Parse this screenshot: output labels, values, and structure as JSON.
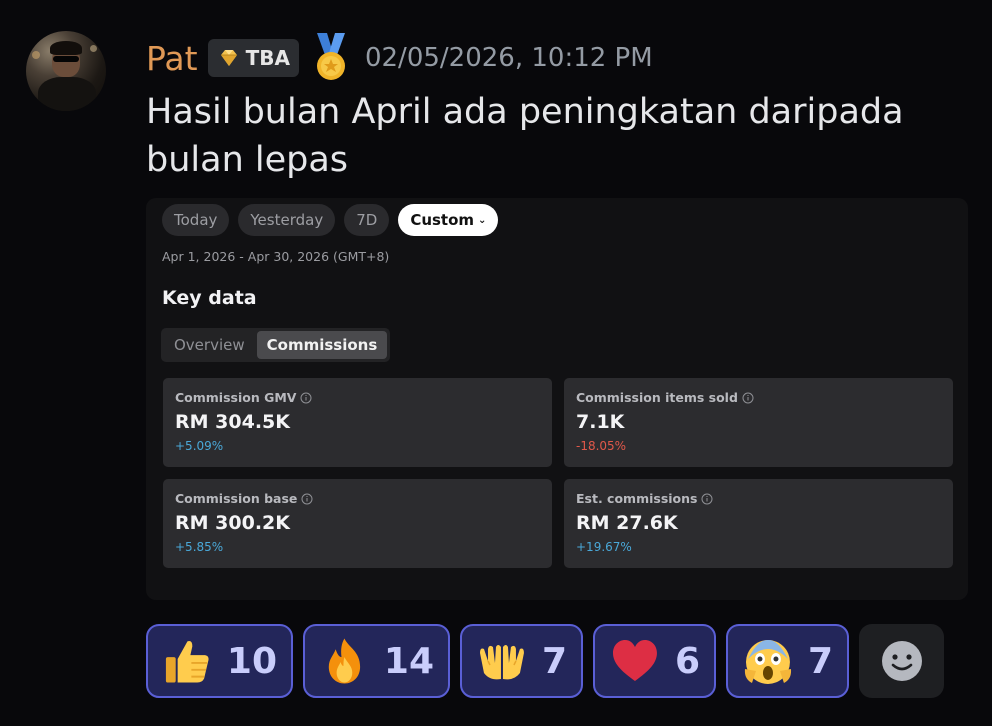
{
  "author": {
    "username": "Pat",
    "tag": "TBA",
    "timestamp": "02/05/2026, 10:12 PM",
    "name_color": "#e09956"
  },
  "message": {
    "text": "Hasil bulan April ada peningkatan daripada bulan lepas"
  },
  "embed": {
    "date_filters": [
      "Today",
      "Yesterday",
      "7D",
      "Custom"
    ],
    "selected_filter": "Custom",
    "date_range": "Apr 1, 2026 - Apr 30, 2026 (GMT+8)",
    "section_title": "Key data",
    "tabs": [
      "Overview",
      "Commissions"
    ],
    "active_tab": "Commissions",
    "metrics": [
      {
        "title": "Commission GMV",
        "value": "RM 304.5K",
        "delta": "+5.09%",
        "trend": "up"
      },
      {
        "title": "Commission items sold",
        "value": "7.1K",
        "delta": "-18.05%",
        "trend": "down"
      },
      {
        "title": "Commission base",
        "value": "RM 300.2K",
        "delta": "+5.85%",
        "trend": "up"
      },
      {
        "title": "Est. commissions",
        "value": "RM 27.6K",
        "delta": "+19.67%",
        "trend": "up"
      }
    ]
  },
  "reactions": [
    {
      "emoji": "thumbs-up",
      "count": "10"
    },
    {
      "emoji": "fire",
      "count": "14"
    },
    {
      "emoji": "palms-up-together",
      "count": "7"
    },
    {
      "emoji": "red-heart",
      "count": "6"
    },
    {
      "emoji": "face-screaming-in-fear",
      "count": "7"
    }
  ],
  "colors": {
    "reaction_bg": "#23265a",
    "reaction_border": "#5a5fd6",
    "positive": "#4aa8d8",
    "negative": "#e0584a"
  }
}
